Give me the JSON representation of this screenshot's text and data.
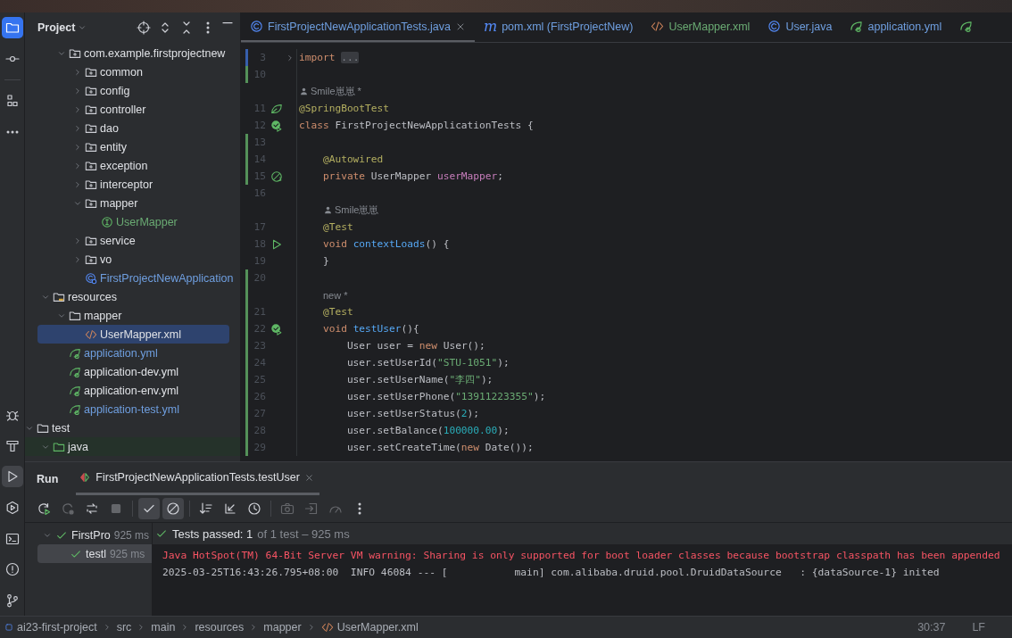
{
  "activity": {
    "top": [
      {
        "kind": "project",
        "selected": true
      },
      {
        "kind": "commit",
        "selected": false
      },
      {
        "kind": "structure",
        "selected": false
      },
      {
        "kind": "more",
        "selected": false
      }
    ],
    "bottom": [
      {
        "kind": "debug",
        "selected": false
      },
      {
        "kind": "build",
        "selected": false
      },
      {
        "kind": "run",
        "selected": true
      },
      {
        "kind": "services",
        "selected": false
      },
      {
        "kind": "terminal",
        "selected": false
      },
      {
        "kind": "problems",
        "selected": false
      },
      {
        "kind": "git",
        "selected": false
      }
    ]
  },
  "project": {
    "title": "Project",
    "tree": [
      {
        "children": [
          {
            "children": [
              {
                "label": "com.example.firstprojectnew",
                "kind": "package",
                "expanded": true,
                "selected": false,
                "children": [
                  {
                    "label": "common",
                    "kind": "package",
                    "expanded": false,
                    "selected": false
                  },
                  {
                    "label": "config",
                    "kind": "package",
                    "expanded": false,
                    "selected": false
                  },
                  {
                    "label": "controller",
                    "kind": "package",
                    "expanded": false,
                    "selected": false
                  },
                  {
                    "label": "dao",
                    "kind": "package",
                    "expanded": false,
                    "selected": false
                  },
                  {
                    "label": "entity",
                    "kind": "package",
                    "expanded": false,
                    "selected": false
                  },
                  {
                    "label": "exception",
                    "kind": "package",
                    "expanded": false,
                    "selected": false
                  },
                  {
                    "label": "interceptor",
                    "kind": "package",
                    "expanded": false,
                    "selected": false
                  },
                  {
                    "label": "mapper",
                    "kind": "package",
                    "expanded": true,
                    "selected": false,
                    "children": [
                      {
                        "label": "UserMapper",
                        "kind": "interface",
                        "selected": false,
                        "color": "#6aab73"
                      }
                    ]
                  },
                  {
                    "label": "service",
                    "kind": "package",
                    "expanded": false,
                    "selected": false
                  },
                  {
                    "label": "vo",
                    "kind": "package",
                    "expanded": false,
                    "selected": false
                  },
                  {
                    "label": "FirstProjectNewApplication",
                    "kind": "app-class",
                    "selected": false,
                    "color": "#6f9fe0"
                  }
                ]
              }
            ]
          },
          {
            "label": "resources",
            "kind": "resources",
            "expanded": true,
            "selected": false,
            "children": [
              {
                "label": "mapper",
                "kind": "folder",
                "expanded": true,
                "selected": false,
                "children": [
                  {
                    "label": "UserMapper.xml",
                    "kind": "xml",
                    "selected": true
                  }
                ]
              },
              {
                "label": "application.yml",
                "kind": "yml",
                "selected": false,
                "color": "#6f9fe0"
              },
              {
                "label": "application-dev.yml",
                "kind": "yml",
                "selected": false
              },
              {
                "label": "application-env.yml",
                "kind": "yml",
                "selected": false
              },
              {
                "label": "application-test.yml",
                "kind": "yml",
                "selected": false,
                "color": "#6f9fe0"
              }
            ]
          }
        ]
      },
      {
        "label": "test",
        "kind": "folder",
        "expanded": true,
        "selected": false,
        "children": [
          {
            "label": "java",
            "kind": "test-sources",
            "expanded": true,
            "selected": false
          }
        ]
      }
    ]
  },
  "editor": {
    "tabs": [
      {
        "label": "FirstProjectNewApplicationTests.java",
        "kind": "class",
        "color": "#6f9fe0",
        "selected": true
      },
      {
        "label": "pom.xml (FirstProjectNew)",
        "kind": "maven",
        "icon_text": "m",
        "color": "#6f9fe0",
        "selected": false
      },
      {
        "label": "UserMapper.xml",
        "kind": "xml",
        "color": "#6aab73",
        "selected": false
      },
      {
        "label": "User.java",
        "kind": "class",
        "color": "#6f9fe0",
        "selected": false
      },
      {
        "label": "application.yml",
        "kind": "yml",
        "color": "#6f9fe0",
        "selected": false
      },
      {
        "kind": "yml",
        "selected": false
      }
    ],
    "lines": [
      {
        "kind": "code",
        "number": "3",
        "color": "#375fad",
        "fold": true,
        "tokens": [
          {
            "text": "import",
            "kind": "keyword"
          },
          {
            "text": "...",
            "kind": "fold"
          }
        ]
      },
      {
        "kind": "code",
        "number": "10",
        "color": "#549159"
      },
      {
        "kind": "author",
        "text": "Smile崽崽 *"
      },
      {
        "kind": "code",
        "number": "11",
        "gutter_icon": {
          "kind": "spring"
        },
        "tokens": [
          {
            "text": "@SpringBootTest",
            "kind": "annotation"
          }
        ]
      },
      {
        "kind": "code",
        "number": "12",
        "gutter_icon": {
          "kind": "passed"
        },
        "tokens": [
          {
            "text": "class",
            "kind": "keyword"
          },
          {
            "text": " FirstProjectNewApplicationTests {",
            "kind": "plain"
          }
        ]
      },
      {
        "kind": "code",
        "number": "13",
        "color": "#549159"
      },
      {
        "kind": "code",
        "number": "14",
        "color": "#549159",
        "tokens": [
          {
            "text": "    @Autowired",
            "kind": "annotation"
          }
        ]
      },
      {
        "kind": "code",
        "number": "15",
        "color": "#549159",
        "gutter_icon": {
          "kind": "bean"
        },
        "tokens": [
          {
            "text": "    private",
            "kind": "keyword"
          },
          {
            "text": " UserMapper ",
            "kind": "plain"
          },
          {
            "text": "userMapper",
            "kind": "field"
          },
          {
            "text": ";",
            "kind": "plain"
          }
        ]
      },
      {
        "kind": "code",
        "number": "16"
      },
      {
        "kind": "author",
        "text": "    Smile崽崽"
      },
      {
        "kind": "code",
        "number": "17",
        "tokens": [
          {
            "text": "    @Test",
            "kind": "annotation"
          }
        ]
      },
      {
        "kind": "code",
        "number": "18",
        "gutter_icon": {
          "kind": "run"
        },
        "tokens": [
          {
            "text": "    void",
            "kind": "keyword"
          },
          {
            "text": " contextLoads",
            "kind": "method"
          },
          {
            "text": "() {",
            "kind": "plain"
          }
        ]
      },
      {
        "kind": "code",
        "number": "19",
        "tokens": [
          {
            "text": "    }",
            "kind": "plain"
          }
        ]
      },
      {
        "kind": "code",
        "number": "20",
        "color": "#549159"
      },
      {
        "kind": "note",
        "text": "    new *",
        "color": "#549159"
      },
      {
        "kind": "code",
        "number": "21",
        "color": "#549159",
        "tokens": [
          {
            "text": "    @Test",
            "kind": "annotation"
          }
        ]
      },
      {
        "kind": "code",
        "number": "22",
        "color": "#549159",
        "gutter_icon": {
          "kind": "passed"
        },
        "tokens": [
          {
            "text": "    void",
            "kind": "keyword"
          },
          {
            "text": " testUser",
            "kind": "method"
          },
          {
            "text": "(){",
            "kind": "plain"
          }
        ]
      },
      {
        "kind": "code",
        "number": "23",
        "color": "#549159",
        "tokens": [
          {
            "text": "        User user = ",
            "kind": "plain"
          },
          {
            "text": "new",
            "kind": "keyword"
          },
          {
            "text": " User();",
            "kind": "plain"
          }
        ]
      },
      {
        "kind": "code",
        "number": "24",
        "color": "#549159",
        "tokens": [
          {
            "text": "        user.setUserId(",
            "kind": "plain"
          },
          {
            "text": "\"STU-1051\"",
            "kind": "string"
          },
          {
            "text": ");",
            "kind": "plain"
          }
        ]
      },
      {
        "kind": "code",
        "number": "25",
        "color": "#549159",
        "tokens": [
          {
            "text": "        user.setUserName(",
            "kind": "plain"
          },
          {
            "text": "\"李四\"",
            "kind": "string"
          },
          {
            "text": ");",
            "kind": "plain"
          }
        ]
      },
      {
        "kind": "code",
        "number": "26",
        "color": "#549159",
        "tokens": [
          {
            "text": "        user.setUserPhone(",
            "kind": "plain"
          },
          {
            "text": "\"13911223355\"",
            "kind": "string"
          },
          {
            "text": ");",
            "kind": "plain"
          }
        ]
      },
      {
        "kind": "code",
        "number": "27",
        "color": "#549159",
        "tokens": [
          {
            "text": "        user.setUserStatus(",
            "kind": "plain"
          },
          {
            "text": "2",
            "kind": "number"
          },
          {
            "text": ");",
            "kind": "plain"
          }
        ]
      },
      {
        "kind": "code",
        "number": "28",
        "color": "#549159",
        "tokens": [
          {
            "text": "        user.setBalance(",
            "kind": "plain"
          },
          {
            "text": "100000.00",
            "kind": "number"
          },
          {
            "text": ");",
            "kind": "plain"
          }
        ]
      },
      {
        "kind": "code",
        "number": "29",
        "color": "#549159",
        "tokens": [
          {
            "text": "        user.setCreateTime(",
            "kind": "plain"
          },
          {
            "text": "new",
            "kind": "keyword"
          },
          {
            "text": " Date());",
            "kind": "plain"
          }
        ]
      }
    ]
  },
  "run": {
    "title": "Run",
    "tabs": [
      {
        "label": "FirstProjectNewApplicationTests.testUser",
        "selected": true
      }
    ],
    "toolbar": [
      {
        "kind": "rerun",
        "disabled": false,
        "on": false
      },
      {
        "kind": "rerun-failed",
        "disabled": true,
        "on": false
      },
      {
        "kind": "toggle-auto",
        "disabled": false,
        "on": false
      },
      {
        "kind": "stop",
        "disabled": true,
        "on": false
      },
      {
        "kind": "separator"
      },
      {
        "kind": "show-passed",
        "disabled": false,
        "on": true
      },
      {
        "kind": "show-ignored",
        "disabled": false,
        "on": true
      },
      {
        "kind": "separator"
      },
      {
        "kind": "sort",
        "disabled": false,
        "on": false
      },
      {
        "kind": "import",
        "disabled": false,
        "on": false
      },
      {
        "kind": "history",
        "disabled": false,
        "on": false
      },
      {
        "kind": "separator"
      },
      {
        "kind": "camera",
        "disabled": true,
        "on": false
      },
      {
        "kind": "export",
        "disabled": true,
        "on": false
      },
      {
        "kind": "speed",
        "disabled": true,
        "on": false
      },
      {
        "kind": "more",
        "disabled": false,
        "on": false
      }
    ],
    "tests": [
      {
        "label": "FirstPro",
        "time": "925 ms",
        "passed": true,
        "expanded": true,
        "selected": false,
        "children": [
          {
            "label": "testl",
            "time": "925 ms",
            "passed": true,
            "selected": true
          }
        ]
      }
    ],
    "summary": {
      "passed": true,
      "main": "Tests passed: 1",
      "detail": "of 1 test – 925 ms"
    },
    "console": [
      {
        "kind": "error",
        "text": "Java HotSpot(TM) 64-Bit Server VM warning: Sharing is only supported for boot loader classes because bootstrap classpath has been appended"
      },
      {
        "kind": "info",
        "text": "2025-03-25T16:43:26.795+08:00  INFO 46084 --- [           main] com.alibaba.druid.pool.DruidDataSource   : {dataSource-1} inited"
      }
    ]
  },
  "status_bar": {
    "breadcrumbs": [
      {
        "label": "ai23-first-project",
        "kind": "module"
      },
      {
        "label": "src",
        "kind": "plain"
      },
      {
        "label": "main",
        "kind": "plain"
      },
      {
        "label": "resources",
        "kind": "plain"
      },
      {
        "label": "mapper",
        "kind": "plain"
      },
      {
        "label": "UserMapper.xml",
        "kind": "xml"
      }
    ],
    "right": [
      "30:37",
      "LF"
    ]
  }
}
